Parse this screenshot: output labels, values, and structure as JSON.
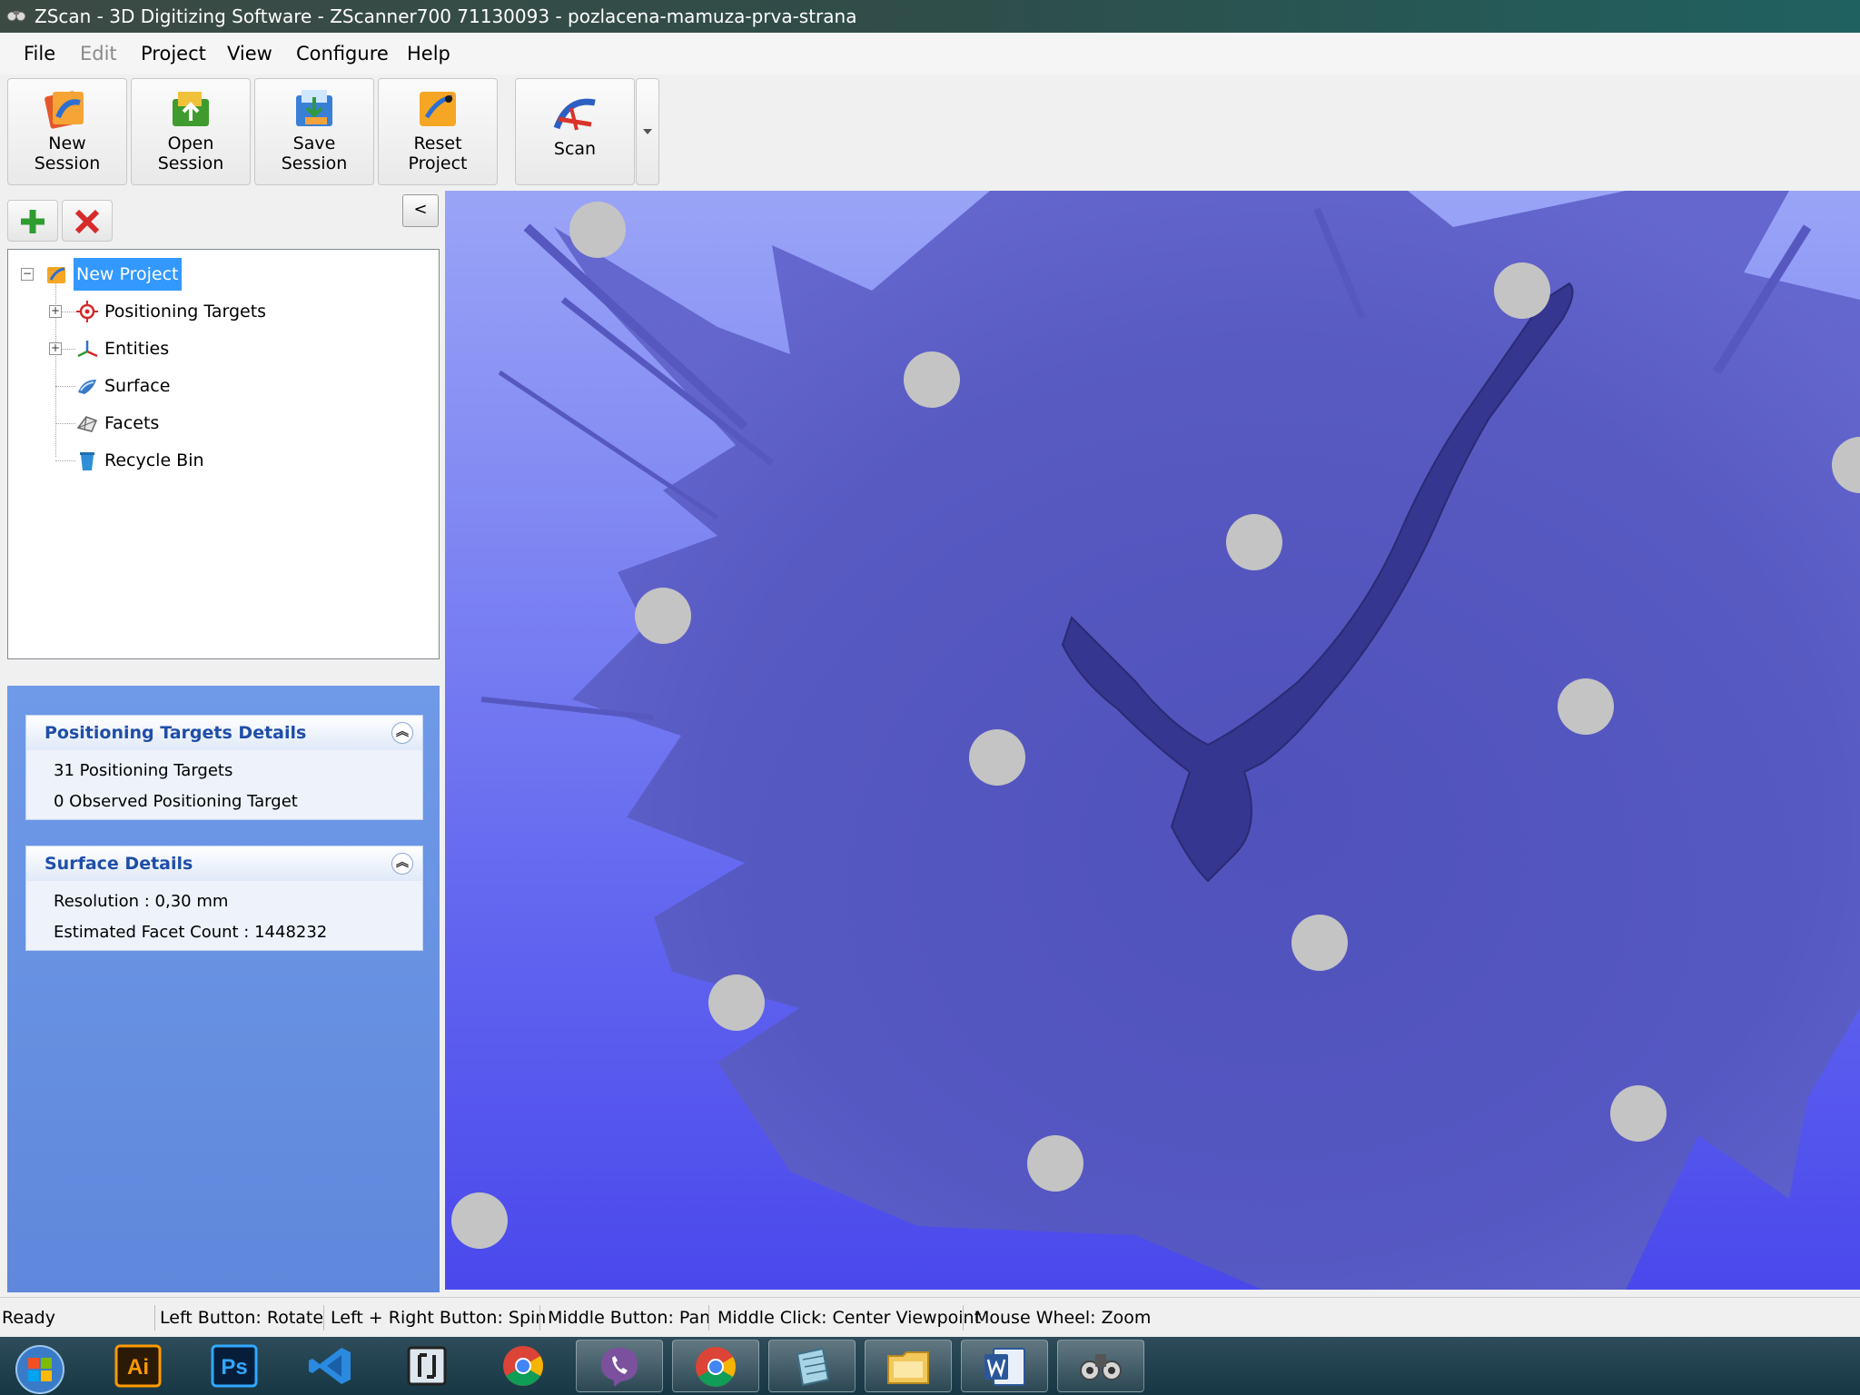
{
  "window": {
    "title": "ZScan - 3D Digitizing Software - ZScanner700 71130093 - pozlacena-mamuza-prva-strana"
  },
  "menu": {
    "file": "File",
    "edit": "Edit",
    "project": "Project",
    "view": "View",
    "configure": "Configure",
    "help": "Help"
  },
  "toolbar": {
    "new_session": "New\nSession",
    "open_session": "Open\nSession",
    "save_session": "Save\nSession",
    "reset_project": "Reset\nProject",
    "scan": "Scan"
  },
  "panel": {
    "collapse_label": "<"
  },
  "tree": {
    "root": "New Project",
    "items": [
      "Positioning Targets",
      "Entities",
      "Surface",
      "Facets",
      "Recycle Bin"
    ]
  },
  "details": {
    "positioning": {
      "title": "Positioning Targets Details",
      "line1": "31 Positioning Targets",
      "line2": "0 Observed Positioning Target"
    },
    "surface": {
      "title": "Surface Details",
      "line1": "Resolution : 0,30 mm",
      "line2": "Estimated Facet Count : 1448232"
    }
  },
  "status": {
    "ready": "Ready",
    "left": "Left Button: Rotate",
    "leftright": "Left + Right Button: Spin",
    "middle": "Middle Button: Pan",
    "middle_click": "Middle Click: Center Viewpoint",
    "wheel": "Mouse Wheel: Zoom"
  },
  "taskbar": {
    "illustrator": "Ai",
    "photoshop": "Ps"
  },
  "colors": {
    "selection": "#3399ff",
    "viewport_top": "#9aa4f6",
    "viewport_bottom": "#4a48ec",
    "mesh": "#5a5cc4",
    "target": "#c4c4c4"
  }
}
